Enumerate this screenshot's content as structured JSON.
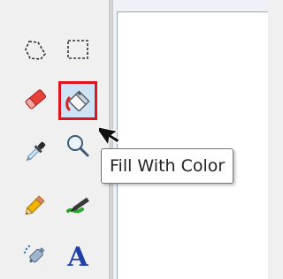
{
  "toolbox": {
    "tools": [
      {
        "name": "free-form-select",
        "icon": "free-form-select-icon"
      },
      {
        "name": "rectangle-select",
        "icon": "rectangle-select-icon"
      },
      {
        "name": "eraser",
        "icon": "eraser-icon"
      },
      {
        "name": "fill-with-color",
        "icon": "paint-bucket-icon",
        "selected": true
      },
      {
        "name": "pick-color",
        "icon": "eyedropper-icon"
      },
      {
        "name": "magnifier",
        "icon": "magnifier-icon"
      },
      {
        "name": "pencil",
        "icon": "pencil-icon"
      },
      {
        "name": "brush",
        "icon": "brush-icon"
      },
      {
        "name": "airbrush",
        "icon": "airbrush-icon"
      },
      {
        "name": "text",
        "icon": "text-icon",
        "glyph": "A"
      }
    ]
  },
  "tooltip": {
    "text": "Fill With Color"
  },
  "colors": {
    "selection_border": "#e0141c",
    "text_tool_blue": "#1c3fa8",
    "canvas": "#ffffff"
  }
}
